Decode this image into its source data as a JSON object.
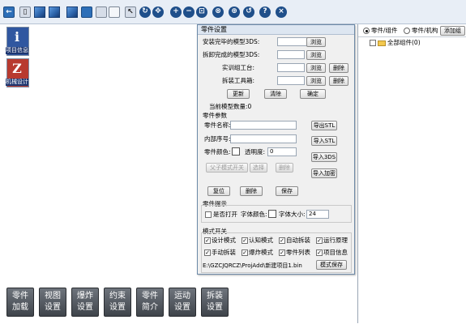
{
  "toolbar": {
    "icons": [
      "back-arrow-icon",
      "document-icon",
      "cube-front-icon",
      "cube-side-icon",
      "cube-top-icon",
      "panel-blue-icon",
      "panel-gray-icon",
      "panel-white-icon",
      "select-cursor-icon",
      "rotate-icon",
      "pan-icon",
      "zoom-in-icon",
      "zoom-out-icon",
      "zoom-fit-icon",
      "explode-icon",
      "assembly-icon",
      "reset-icon",
      "help-icon",
      "close-icon"
    ]
  },
  "left_icons": [
    {
      "label": "项目信息",
      "glyph": "i"
    },
    {
      "label": "机械设计",
      "glyph": "Z"
    }
  ],
  "dialog": {
    "title": "零件设置",
    "install_model_label": "安装完毕的模型3DS:",
    "disassemble_model_label": "拆卸完成的模型3DS:",
    "workbench_label": "实训组工台:",
    "toolbox_label": "拆装工具箱:",
    "browse": "浏览",
    "delete": "删除",
    "update": "更新",
    "clear": "清除",
    "confirm": "确定",
    "model_count": "当前模型数量:0",
    "params_header": "零件参数",
    "part_name_label": "零件名称:",
    "inner_seq_label": "内部序号:",
    "part_color_label": "零件颜色:",
    "transparency_label": "透明度:",
    "transparency_value": "0",
    "export_stl": "导出STL",
    "import_stl": "导入STL",
    "import_3ds": "导入3DS",
    "import_add": "导入加密",
    "parent_child_switch": "父子模式开关",
    "select": "选择",
    "delete2": "删除",
    "reset": "复位",
    "delete3": "删除",
    "save": "保存",
    "hint_header": "零件提示",
    "open_hint": "是否打开",
    "font_color_label": "字体颜色:",
    "font_size_label": "字体大小:",
    "font_size_value": "24",
    "mode_header": "模式开关",
    "modes": [
      "设计模式",
      "认知模式",
      "自动拆装",
      "运行原理",
      "手动拆装",
      "爆炸模式",
      "零件列表",
      "项目信息"
    ],
    "file_path": "E:\\GZCJQRCZ\\ProjAdd\\新建项目1.bin",
    "mode_save": "模式保存"
  },
  "right_panel": {
    "radio_parts": "零件/组件",
    "radio_mechanism": "零件/机构",
    "add_group": "添加组",
    "tree_root": "全部组件(0)"
  },
  "bottom_buttons": [
    {
      "line1": "零件",
      "line2": "加载"
    },
    {
      "line1": "视图",
      "line2": "设置"
    },
    {
      "line1": "爆炸",
      "line2": "设置"
    },
    {
      "line1": "约束",
      "line2": "设置"
    },
    {
      "line1": "零件",
      "line2": "简介"
    },
    {
      "line1": "运动",
      "line2": "设置"
    },
    {
      "line1": "拆装",
      "line2": "设置"
    }
  ]
}
